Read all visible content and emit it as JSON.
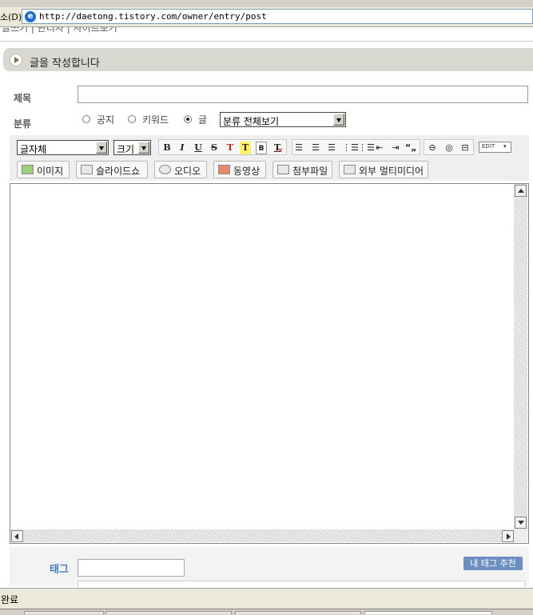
{
  "browser": {
    "address_label": "소(D)",
    "url": "http://daetong.tistory.com/owner/entry/post",
    "status": "완료"
  },
  "nav": {
    "partial_text": "글쓰기 | 관리자 | 사이트보기"
  },
  "header": {
    "title": "글을 작성합니다"
  },
  "form": {
    "title_label": "제목",
    "title_value": "",
    "category_label": "분류",
    "radios": [
      {
        "label": "공지",
        "checked": false
      },
      {
        "label": "키워드",
        "checked": false
      },
      {
        "label": "글",
        "checked": true
      }
    ],
    "category_select": "분류 전체보기"
  },
  "toolbar": {
    "font_select": "글자체",
    "size_select": "크기",
    "format_buttons": [
      "B",
      "I",
      "U",
      "S",
      "T",
      "T",
      "B",
      "T"
    ],
    "edit_label": "EDIT",
    "media_buttons": [
      "이미지",
      "슬라이드쇼",
      "오디오",
      "동영상",
      "첨부파일",
      "외부 멀티미디어"
    ]
  },
  "tags": {
    "label": "태그",
    "value": "",
    "recommend_button": "내 태그 추천"
  },
  "colors": {
    "header_band": "#d8d8d0",
    "tag_label": "#4a7cbf",
    "recommend_bg": "#6b8fc0"
  }
}
